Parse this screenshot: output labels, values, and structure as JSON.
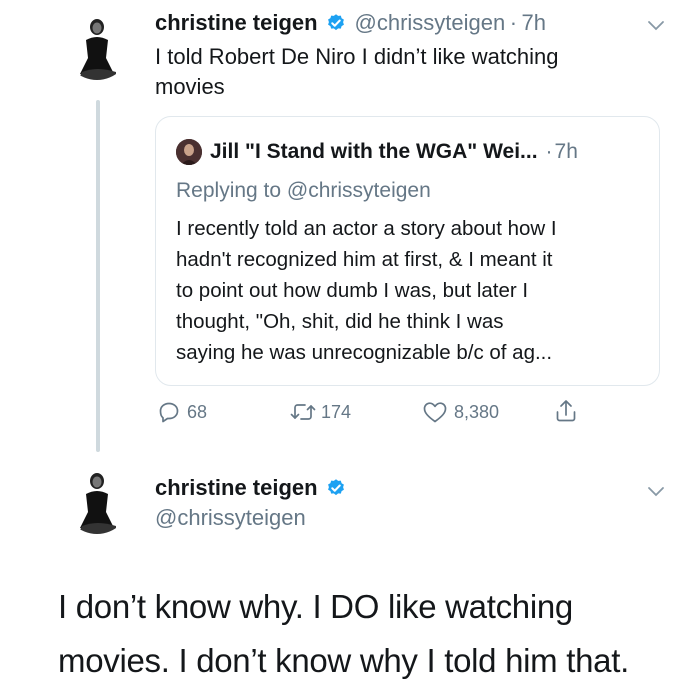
{
  "tweet1": {
    "author_name": "christine teigen",
    "handle": "@chrissyteigen",
    "separator": "·",
    "time": "7h",
    "text_line1": "I told Robert De Niro I didn’t like watching",
    "text_line2": "movies"
  },
  "quote": {
    "author_name": "Jill \"I Stand with the WGA\" Wei...",
    "separator": "·",
    "time": "7h",
    "replying_prefix": "Replying to",
    "replying_handle": "@chrissyteigen",
    "lines": [
      "I recently told an actor a story about how I",
      "hadn't recognized him at first, & I meant it",
      "to point out how dumb I was, but later I",
      "thought, \"Oh, shit, did he think I was",
      "saying he was unrecognizable b/c of ag..."
    ]
  },
  "actions": {
    "replies": "68",
    "retweets": "174",
    "likes": "8,380"
  },
  "tweet2": {
    "author_name": "christine teigen",
    "handle": "@chrissyteigen",
    "text_line1": "I don’t know why. I DO like watching",
    "text_line2": "movies. I don’t know why I told him that."
  },
  "colors": {
    "verified_blue": "#1da1f2",
    "secondary_text": "#657786",
    "border": "#e1e8ed"
  },
  "icons": [
    "verified-badge-icon",
    "chevron-down-icon",
    "reply-icon",
    "retweet-icon",
    "like-icon",
    "share-icon"
  ]
}
